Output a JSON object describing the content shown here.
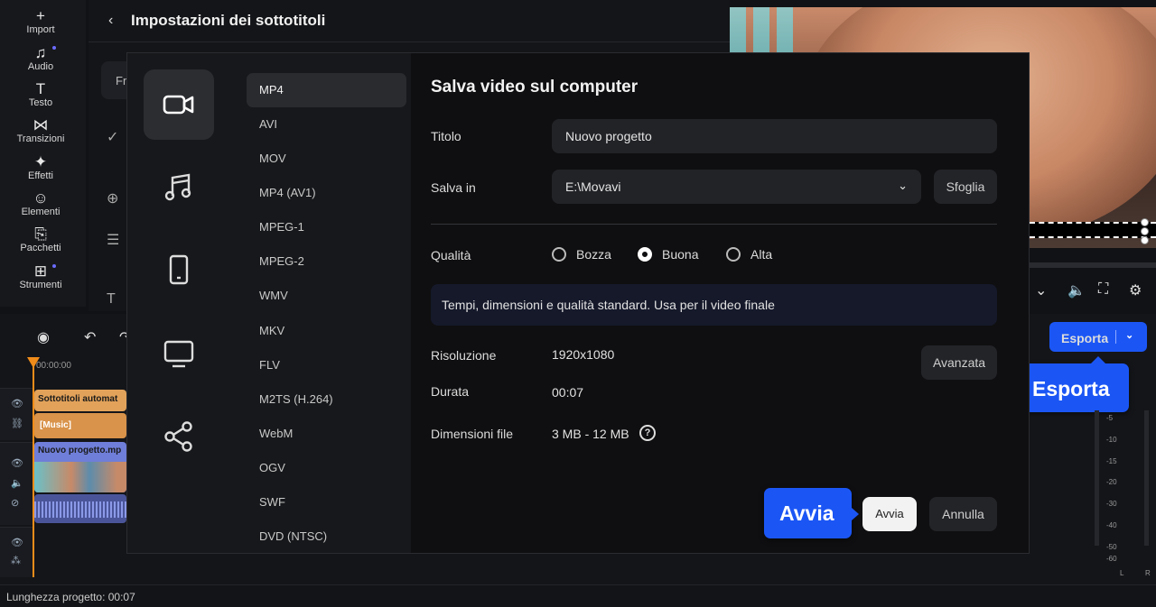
{
  "toolbar": {
    "items": [
      {
        "label": "Import",
        "icon": "plus-icon"
      },
      {
        "label": "Audio",
        "icon": "music-note-icon"
      },
      {
        "label": "Testo",
        "icon": "text-icon"
      },
      {
        "label": "Transizioni",
        "icon": "bowtie-icon"
      },
      {
        "label": "Effetti",
        "icon": "sparkle-icon"
      },
      {
        "label": "Elementi",
        "icon": "smiley-icon"
      },
      {
        "label": "Pacchetti",
        "icon": "package-icon"
      },
      {
        "label": "Strumenti",
        "icon": "grid-icon"
      }
    ]
  },
  "subtitle_panel": {
    "title": "Impostazioni dei sottotitoli",
    "field_text": "Fr"
  },
  "export": {
    "button_label": "Esporta",
    "callout_label": "Esporta"
  },
  "timeline": {
    "timecode": "00:00:00",
    "clips": {
      "subtitles": "Sottotitoli automat",
      "music": "[Music]",
      "video": "Nuovo progetto.mp"
    },
    "meter_ticks": [
      "-5",
      "-10",
      "-15",
      "-20",
      "-30",
      "-40",
      "-50",
      "-60"
    ],
    "meter_channels": [
      "L",
      "R"
    ]
  },
  "status": {
    "project_length": "Lunghezza progetto: 00:07"
  },
  "dialog": {
    "title": "Salva video sul computer",
    "formats": [
      "MP4",
      "AVI",
      "MOV",
      "MP4 (AV1)",
      "MPEG-1",
      "MPEG-2",
      "WMV",
      "MKV",
      "FLV",
      "M2TS (H.264)",
      "WebM",
      "OGV",
      "SWF",
      "DVD (NTSC)"
    ],
    "selected_format": "MP4",
    "title_label": "Titolo",
    "title_value": "Nuovo progetto",
    "save_in_label": "Salva in",
    "save_in_value": "E:\\Movavi",
    "browse_label": "Sfoglia",
    "quality_label": "Qualità",
    "quality_options": [
      "Bozza",
      "Buona",
      "Alta"
    ],
    "quality_selected": "Buona",
    "quality_info": "Tempi, dimensioni e qualità standard. Usa per il video finale",
    "resolution_label": "Risoluzione",
    "resolution_value": "1920x1080",
    "advanced_label": "Avanzata",
    "duration_label": "Durata",
    "duration_value": "00:07",
    "filesize_label": "Dimensioni file",
    "filesize_value": "3 MB - 12 MB",
    "start_label": "Avvia",
    "cancel_label": "Annulla",
    "start_callout": "Avvia"
  },
  "colors": {
    "accent": "#1b56f5",
    "playhead": "#f08c1a",
    "subtitle_clip": "#e2a25a",
    "video_clip": "#6f7ed8"
  }
}
